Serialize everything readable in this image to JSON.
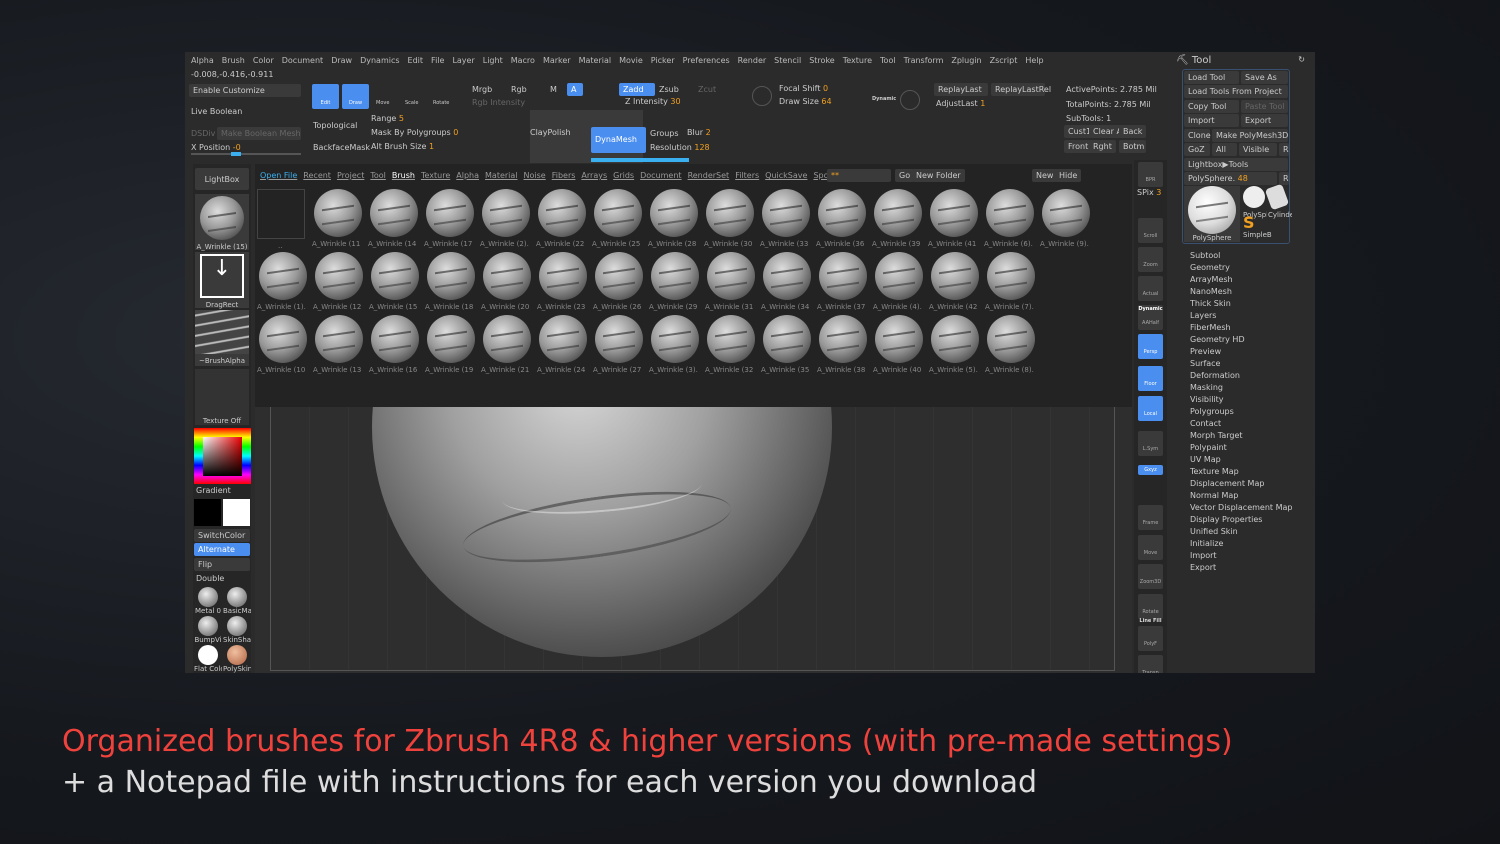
{
  "menu": [
    "Alpha",
    "Brush",
    "Color",
    "Document",
    "Draw",
    "Dynamics",
    "Edit",
    "File",
    "Layer",
    "Light",
    "Macro",
    "Marker",
    "Material",
    "Movie",
    "Picker",
    "Preferences",
    "Render",
    "Stencil",
    "Stroke",
    "Texture",
    "Tool",
    "Transform",
    "Zplugin",
    "Zscript",
    "Help"
  ],
  "coords": "-0.008,-0.416,-0.911",
  "left_top": {
    "enable_customize": "Enable Customize",
    "live_boolean": "Live Boolean",
    "dsdiv": "DSDiv",
    "make_boolean": "Make Boolean Mesh",
    "xpos_label": "X Position",
    "xpos_val": "-0"
  },
  "tools": {
    "edit": "Edit",
    "draw": "Draw",
    "move": "Move",
    "scale": "Scale",
    "rotate": "Rotate"
  },
  "topo": {
    "topological": "Topological",
    "backface": "BackfaceMask",
    "range_label": "Range",
    "range_val": "5",
    "mask_label": "Mask By Polygroups",
    "mask_val": "0",
    "alt_label": "Alt Brush Size",
    "alt_val": "1"
  },
  "color": {
    "mrgb": "Mrgb",
    "rgb": "Rgb",
    "m": "M",
    "a": "A",
    "rgb_intensity": "Rgb Intensity"
  },
  "z": {
    "zadd": "Zadd",
    "zsub": "Zsub",
    "zcut": "Zcut",
    "zint_label": "Z Intensity",
    "zint_val": "30"
  },
  "claypolish": "ClayPolish",
  "dyna": {
    "dynamesh": "DynaMesh",
    "groups": "Groups",
    "blur_label": "Blur",
    "blur_val": "2",
    "res_label": "Resolution",
    "res_val": "128"
  },
  "focal": {
    "focal_label": "Focal Shift",
    "focal_val": "0",
    "draw_label": "Draw Size",
    "draw_val": "64",
    "dynamic": "Dynamic"
  },
  "replay": {
    "replay_last": "ReplayLast",
    "replay_last_rel": "ReplayLastRel",
    "adjust_label": "AdjustLast",
    "adjust_val": "1"
  },
  "stats": {
    "active": "ActivePoints: 2.785 Mil",
    "total": "TotalPoints: 2.785 Mil",
    "subtools": "SubTools: 1",
    "cust1": "Cust1",
    "clear_all": "Clear All",
    "back": "Back",
    "front": "Front",
    "rght": "Rght",
    "botm": "Botm"
  },
  "lightbox": {
    "tabs": [
      "Open File",
      "Recent",
      "Project",
      "Tool",
      "Brush",
      "Texture",
      "Alpha",
      "Material",
      "Noise",
      "Fibers",
      "Arrays",
      "Grids",
      "Document",
      "RenderSet",
      "Filters",
      "QuickSave",
      "Spotlight"
    ],
    "path": "**",
    "go": "Go",
    "new_folder": "New Folder",
    "new": "New",
    "hide": "Hide",
    "folder": ".."
  },
  "brushes": [
    [
      "A_Wrinkle (11",
      "A_Wrinkle (14",
      "A_Wrinkle (17",
      "A_Wrinkle (2).",
      "A_Wrinkle (22",
      "A_Wrinkle (25",
      "A_Wrinkle (28",
      "A_Wrinkle (30",
      "A_Wrinkle (33",
      "A_Wrinkle (36",
      "A_Wrinkle (39",
      "A_Wrinkle (41",
      "A_Wrinkle (6).",
      "A_Wrinkle (9)."
    ],
    [
      "A_Wrinkle (1).",
      "A_Wrinkle (12",
      "A_Wrinkle (15",
      "A_Wrinkle (18",
      "A_Wrinkle (20",
      "A_Wrinkle (23",
      "A_Wrinkle (26",
      "A_Wrinkle (29",
      "A_Wrinkle (31",
      "A_Wrinkle (34",
      "A_Wrinkle (37",
      "A_Wrinkle (4).",
      "A_Wrinkle (42",
      "A_Wrinkle (7)."
    ],
    [
      "A_Wrinkle (10",
      "A_Wrinkle (13",
      "A_Wrinkle (16",
      "A_Wrinkle (19",
      "A_Wrinkle (21",
      "A_Wrinkle (24",
      "A_Wrinkle (27",
      "A_Wrinkle (3).",
      "A_Wrinkle (32",
      "A_Wrinkle (35",
      "A_Wrinkle (38",
      "A_Wrinkle (40",
      "A_Wrinkle (5).",
      "A_Wrinkle (8)."
    ]
  ],
  "left_shelf": {
    "lightbox": "LightBox",
    "brush": "A_Wrinkle (15)",
    "stroke": "DragRect",
    "alpha": "~BrushAlpha",
    "texture": "Texture Off",
    "gradient": "Gradient",
    "switch": "SwitchColor",
    "alternate": "Alternate",
    "flip": "Flip",
    "double": "Double",
    "materials": [
      "Metal 0",
      "BasicMa",
      "BumpVi",
      "SkinSha",
      "Flat Colo",
      "PolySkin"
    ]
  },
  "right_shelf": {
    "bpr": "BPR",
    "spix_label": "SPix",
    "spix_val": "3",
    "buttons": [
      "Scroll",
      "Zoom",
      "Actual",
      "AAHalf",
      "Persp",
      "Floor",
      "Local",
      "L.Sym",
      "Gxyz",
      "Frame",
      "Move",
      "Zoom3D",
      "Rotate",
      "PolyF",
      "Transp"
    ],
    "dynamic": "Dynamic",
    "line_fill": "Line Fill"
  },
  "tool_palette": {
    "title": "Tool",
    "load_tool": "Load Tool",
    "save_as": "Save As",
    "load_from_project": "Load Tools From Project",
    "copy_tool": "Copy Tool",
    "paste_tool": "Paste Tool",
    "import": "Import",
    "export": "Export",
    "clone": "Clone",
    "make_polymesh": "Make PolyMesh3D",
    "goz": "GoZ",
    "all": "All",
    "visible": "Visible",
    "r": "R",
    "lightbox_tools": "Lightbox▶Tools",
    "current_label": "PolySphere.",
    "current_val": "48",
    "thumbs": [
      "PolySphere",
      "PolySph",
      "Cylinder",
      "SimpleB"
    ],
    "sections": [
      "Subtool",
      "Geometry",
      "ArrayMesh",
      "NanoMesh",
      "Thick Skin",
      "Layers",
      "FiberMesh",
      "Geometry HD",
      "Preview",
      "Surface",
      "Deformation",
      "Masking",
      "Visibility",
      "Polygroups",
      "Contact",
      "Morph Target",
      "Polypaint",
      "UV Map",
      "Texture Map",
      "Displacement Map",
      "Normal Map",
      "Vector Displacement Map",
      "Display Properties",
      "Unified Skin",
      "Initialize",
      "Import",
      "Export"
    ]
  },
  "caption": {
    "line1": "Organized brushes for Zbrush 4R8 & higher versions (with pre-made settings)",
    "line2": "+ a Notepad file with instructions for each version you download"
  },
  "colors": {
    "accent": "#4a8ef0",
    "value": "#f0a020",
    "caption_red": "#f0423c"
  }
}
